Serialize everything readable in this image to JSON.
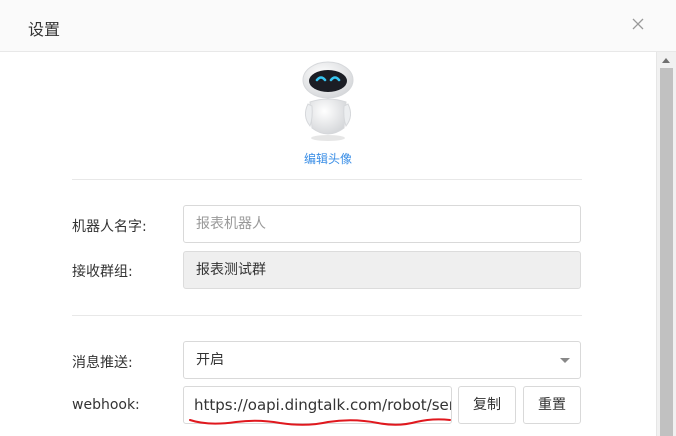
{
  "dialog": {
    "title": "设置",
    "edit_avatar_label": "编辑头像"
  },
  "form": {
    "robot_name_label": "机器人名字:",
    "robot_name_placeholder": "报表机器人",
    "group_label": "接收群组:",
    "group_value": "报表测试群",
    "push_label": "消息推送:",
    "push_value": "开启",
    "webhook_label": "webhook:",
    "webhook_value": "https://oapi.dingtalk.com/robot/send",
    "copy_label": "复制",
    "reset_label": "重置"
  },
  "colors": {
    "link": "#3a8ee6",
    "annotation": "#e0181e"
  }
}
